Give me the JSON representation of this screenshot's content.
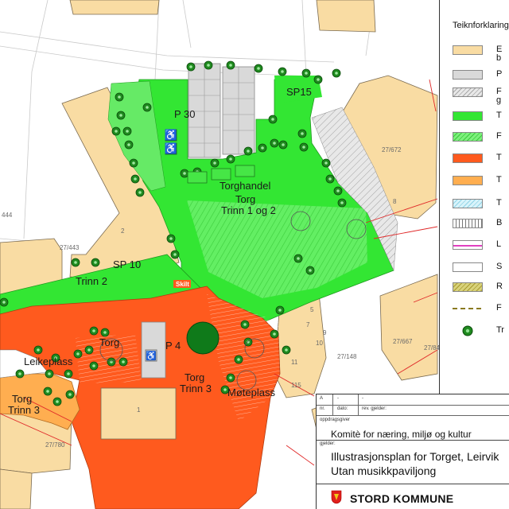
{
  "map": {
    "labels": {
      "p30": "P 30",
      "sp15": "SP15",
      "torghandel": "Torghandel",
      "torg_main": "Torg",
      "trinn_1_2": "Trinn 1 og 2",
      "sp10": "SP 10",
      "trinn2": "Trinn 2",
      "skilt": "Skilt",
      "torg_left": "Torg",
      "p4": "P 4",
      "leikeplass": "Leikeplass",
      "torg_trinn3_a": "Torg",
      "trinn3_a": "Trinn 3",
      "torg_trinn3_b": "Torg",
      "trinn3_b": "Trinn 3",
      "moteplass": "Møteplass",
      "lot_2": "2",
      "lot_8": "8",
      "lot_1": "1",
      "lot_444": "444",
      "parcel_27_443": "27/443",
      "parcel_27_672": "27/672",
      "parcel_27_667": "27/667",
      "parcel_27_84": "27/84",
      "parcel_27_148": "27/148",
      "parcel_27_780": "27/780",
      "num_7": "7",
      "num_11": "11",
      "num_5": "5",
      "num_9": "9",
      "num_10": "10",
      "num_115": "115"
    }
  },
  "legend": {
    "title": "Teiknforklaring",
    "items": [
      {
        "text": "E",
        "text2": "b",
        "color": "#f9dca3",
        "pattern": "solid"
      },
      {
        "text": "P",
        "color": "#d9d9d9",
        "pattern": "solid"
      },
      {
        "text": "F",
        "text2": "g",
        "color": "#e2e2e2",
        "pattern": "hatch"
      },
      {
        "text": "T",
        "color": "#33e633",
        "pattern": "solid"
      },
      {
        "text": "F",
        "color": "#66f066",
        "pattern": "hatch-green"
      },
      {
        "text": "T",
        "color": "#ff5a1e",
        "pattern": "solid"
      },
      {
        "text": "T",
        "color": "#ffae50",
        "pattern": "solid"
      },
      {
        "text": "T",
        "color": "#bfeaf5",
        "pattern": "hatch-cyan"
      },
      {
        "text": "B",
        "color": "#ffffff",
        "pattern": "stripes"
      },
      {
        "text": "L",
        "color": "#ffffff",
        "pattern": "pink-line"
      },
      {
        "text": "S",
        "color": "#ffffff",
        "pattern": "plain"
      },
      {
        "text": "R",
        "color": "#c8c060",
        "pattern": "hatch-olive"
      },
      {
        "text": "F",
        "color": "#ffffff",
        "pattern": "dash-line"
      },
      {
        "text": "Tr",
        "color": "#1a7a1a",
        "pattern": "tree"
      }
    ]
  },
  "titleblock": {
    "rev_rows": [
      {
        "a": "A",
        "b": "-",
        "c": "-"
      },
      {
        "a": "nr.",
        "b": "dato:",
        "c": "rev. gjelder:"
      }
    ],
    "client_caption": "oppdragsgiver",
    "client": "Komitè for næring, miljø og kultur",
    "subject_caption": "gjelder:",
    "title_line1": "Illustrasjonsplan for Torget, Leirvik",
    "title_line2": "Utan musikkpaviljong",
    "brand": "STORD KOMMUNE"
  },
  "colors": {
    "green": "#33e633",
    "green_hatch": "#66f066",
    "orange_red": "#ff5a1e",
    "orange": "#ffae50",
    "building": "#f9dca3",
    "parking": "#d9d9d9",
    "property_line": "#e02828",
    "tree": "#1a7a1a"
  }
}
